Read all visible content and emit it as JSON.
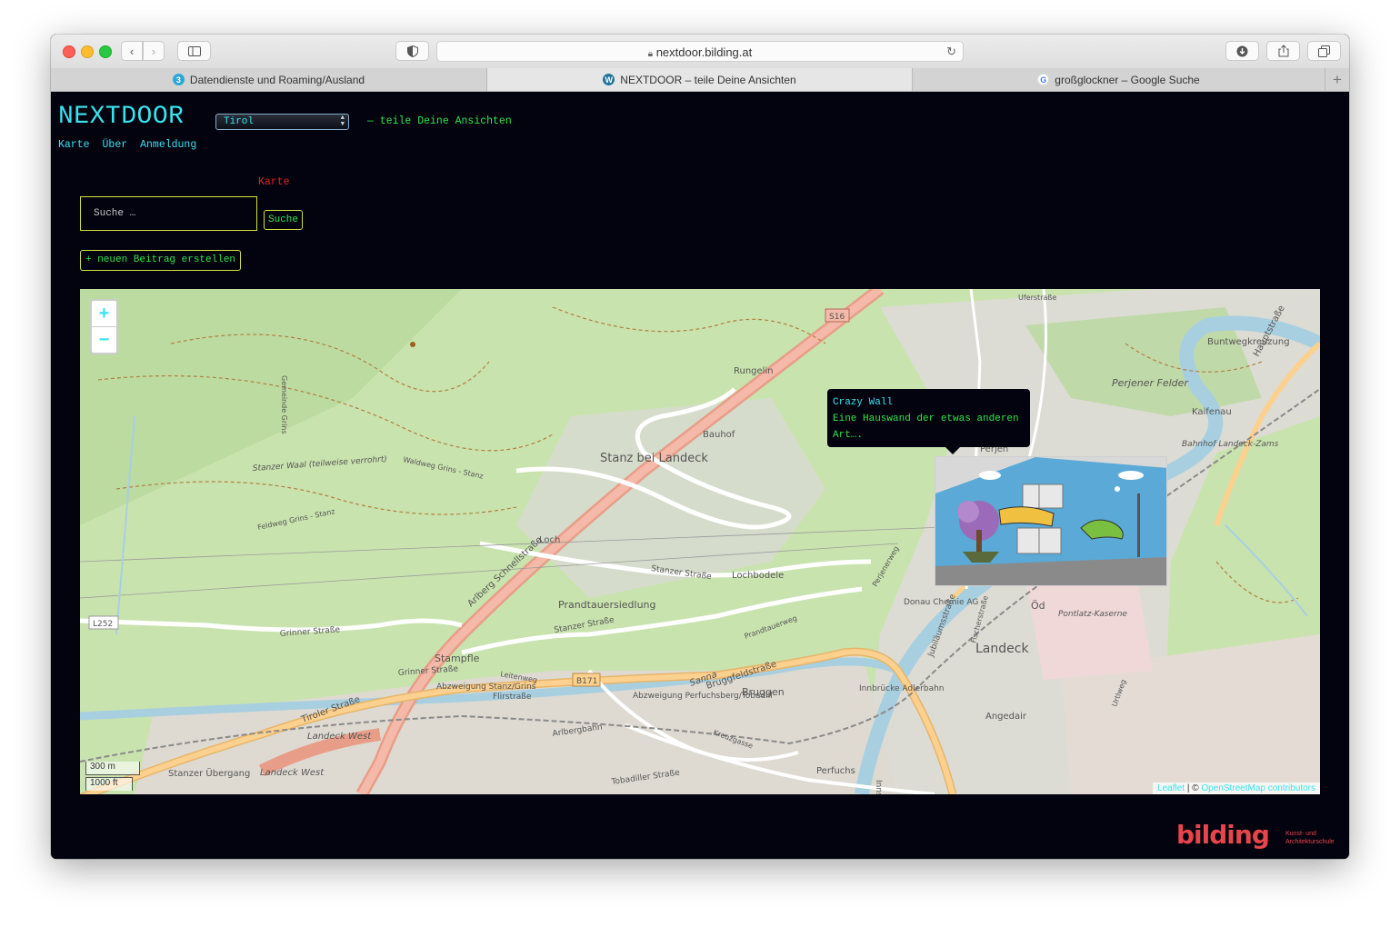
{
  "browser": {
    "url": "nextdoor.bilding.at",
    "tabs": [
      {
        "label": "Datendienste und Roaming/Ausland",
        "icon": "number-3-icon"
      },
      {
        "label": "NEXTDOOR – teile Deine Ansichten",
        "icon": "wordpress-icon"
      },
      {
        "label": "großglockner – Google Suche",
        "icon": "google-icon"
      }
    ]
  },
  "site": {
    "title": "NEXTDOOR",
    "region": "Tirol",
    "tagline": "— teile Deine Ansichten",
    "nav": [
      "Karte",
      "Über",
      "Anmeldung"
    ]
  },
  "main": {
    "heading": "Karte",
    "search_placeholder": "Suche …",
    "search_button": "Suche",
    "new_post_button": "+ neuen Beitrag erstellen"
  },
  "map": {
    "zoom_in": "+",
    "zoom_out": "−",
    "scale_metric": "300 m",
    "scale_imperial": "1000 ft",
    "attribution_leaflet": "Leaflet",
    "attribution_sep": " | © ",
    "attribution_osm": "OpenStreetMap contributors",
    "popup": {
      "title": "Crazy Wall",
      "description": "Eine Hauswand der etwas anderen Art…."
    },
    "labels": {
      "stanz": "Stanz bei Landeck",
      "landeck": "Landeck",
      "bauhof": "Bauhof",
      "rungelin": "Rungelin",
      "loch": "Loch",
      "lochbodele": "Lochbodele",
      "prandtauersiedlung": "Prandtauersiedlung",
      "stampfle": "Stampfle",
      "bruggen": "Bruggen",
      "perfuchs": "Perfuchs",
      "angedair": "Angedair",
      "perjen": "Perjen",
      "perjener_felder": "Perjener Felder",
      "kaifenau": "Kaifenau",
      "buntwegkreuzung": "Buntwegkreuzung",
      "donau_chemie": "Donau Chemie AG",
      "pontlatz": "Pontlatz-Kaserne",
      "od": "Öd",
      "innbruecke": "Innbrücke Adlerbahn",
      "abzweigung_stanz": "Abzweigung Stanz/Grins",
      "abzweigung_perf": "Abzweigung Perfuchsberg/Tobadill",
      "flirstrasse": "Flirstraße",
      "stanzer_uebergang": "Stanzer Übergang",
      "landeck_west_1": "Landeck West",
      "landeck_west_2": "Landeck West",
      "l252": "L252",
      "b171": "B171",
      "s16": "S16",
      "arlberg_schnellstrasse": "Arlberg Schnellstraße",
      "tiroler_strasse": "Tiroler Straße",
      "grinner_strasse": "Grinner Straße",
      "grinner_strasse_2": "Grinner Straße",
      "bruggfeldstrasse": "Bruggfeldstraße",
      "stanzer_strasse": "Stanzer Straße",
      "stanzer_strasse_2": "Stanzer Straße",
      "jubilaeumsstrasse": "Jubiläumsstraße",
      "innstrasse": "Innstraße",
      "hauptstrasse": "Hauptstraße",
      "tobadiller_strasse": "Tobadiller Straße",
      "stanzer_waal": "Stanzer Waal (teilweise verrohrt)",
      "waldweg_grins_stanz": "Waldweg Grins - Stanz",
      "feldweg_grins_stanz": "Feldweg Grins - Stanz",
      "arlbergbahn": "Arlbergbahn",
      "sanna": "Sanna",
      "leitenweg": "Leitenweg",
      "prandtauerweg": "Prandtauerweg",
      "perjenerweg": "Perjenerweg",
      "kreuzgasse": "Kreuzgasse",
      "urtlweg": "Urtlweg",
      "fischerstrasse": "Fischerstraße",
      "gemeindegrins": "Gemeinde Grins",
      "uferstrasse": "Uferstraße",
      "bahnhof": "Bahnhof Landeck-Zams"
    }
  },
  "footer": {
    "logo": "bilding",
    "logo_sub": "Kunst- und Architekturschule"
  },
  "colors": {
    "background": "#02030f",
    "cyan": "#39e3ee",
    "green": "#2ee64a",
    "red": "#e02020",
    "yellow_border": "#d4df3b",
    "logo": "#e8454a"
  }
}
